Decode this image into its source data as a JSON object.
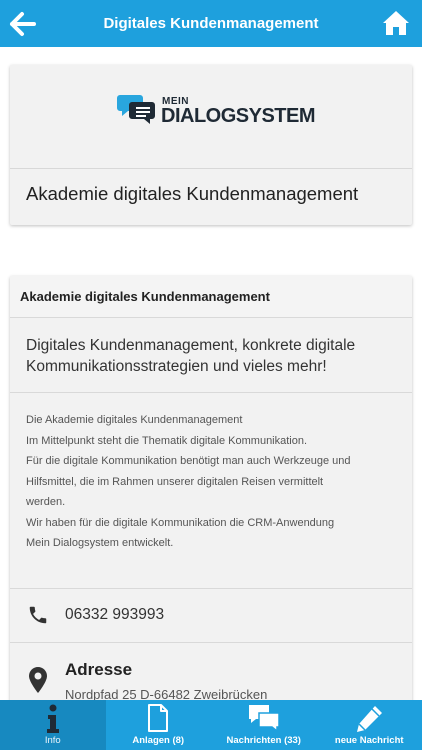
{
  "header": {
    "title": "Digitales Kundenmanagement",
    "back_icon": "back-arrow-icon",
    "home_icon": "home-icon"
  },
  "brand_card": {
    "logo_top": "MEIN",
    "logo_main": "DIALOGSYSTEM",
    "title": "Akademie digitales Kundenmanagement"
  },
  "detail_card": {
    "header": "Akademie digitales Kundenmanagement",
    "subtitle_line1": "Digitales Kundenmanagement, konkrete digitale",
    "subtitle_line2": "Kommunikationsstrategien und vieles mehr!",
    "description": [
      "Die Akademie digitales Kundenmanagement",
      "Im Mittelpunkt steht die Thematik digitale Kommunikation.",
      "Für die digitale Kommunikation benötigt man auch Werkzeuge und",
      "Hilfsmittel, die im Rahmen unserer digitalen Reisen vermittelt",
      "werden.",
      "Wir haben für die digitale Kommunikation die CRM-Anwendung",
      "Mein Dialogsystem entwickelt."
    ],
    "phone": "06332 993993",
    "address_label": "Adresse",
    "address_value": "Nordpfad 25 D-66482 Zweibrücken"
  },
  "tabs": [
    {
      "label": "Info",
      "icon": "info-icon"
    },
    {
      "label": "Anlagen (8)",
      "icon": "document-icon"
    },
    {
      "label": "Nachrichten (33)",
      "icon": "chat-icon"
    },
    {
      "label": "neue Nachricht",
      "icon": "pencil-icon"
    }
  ],
  "colors": {
    "accent": "#1ea0dd",
    "active_tab": "#1789c0",
    "card_bg": "#f2f2f2",
    "logo_text": "#1f2a35"
  }
}
